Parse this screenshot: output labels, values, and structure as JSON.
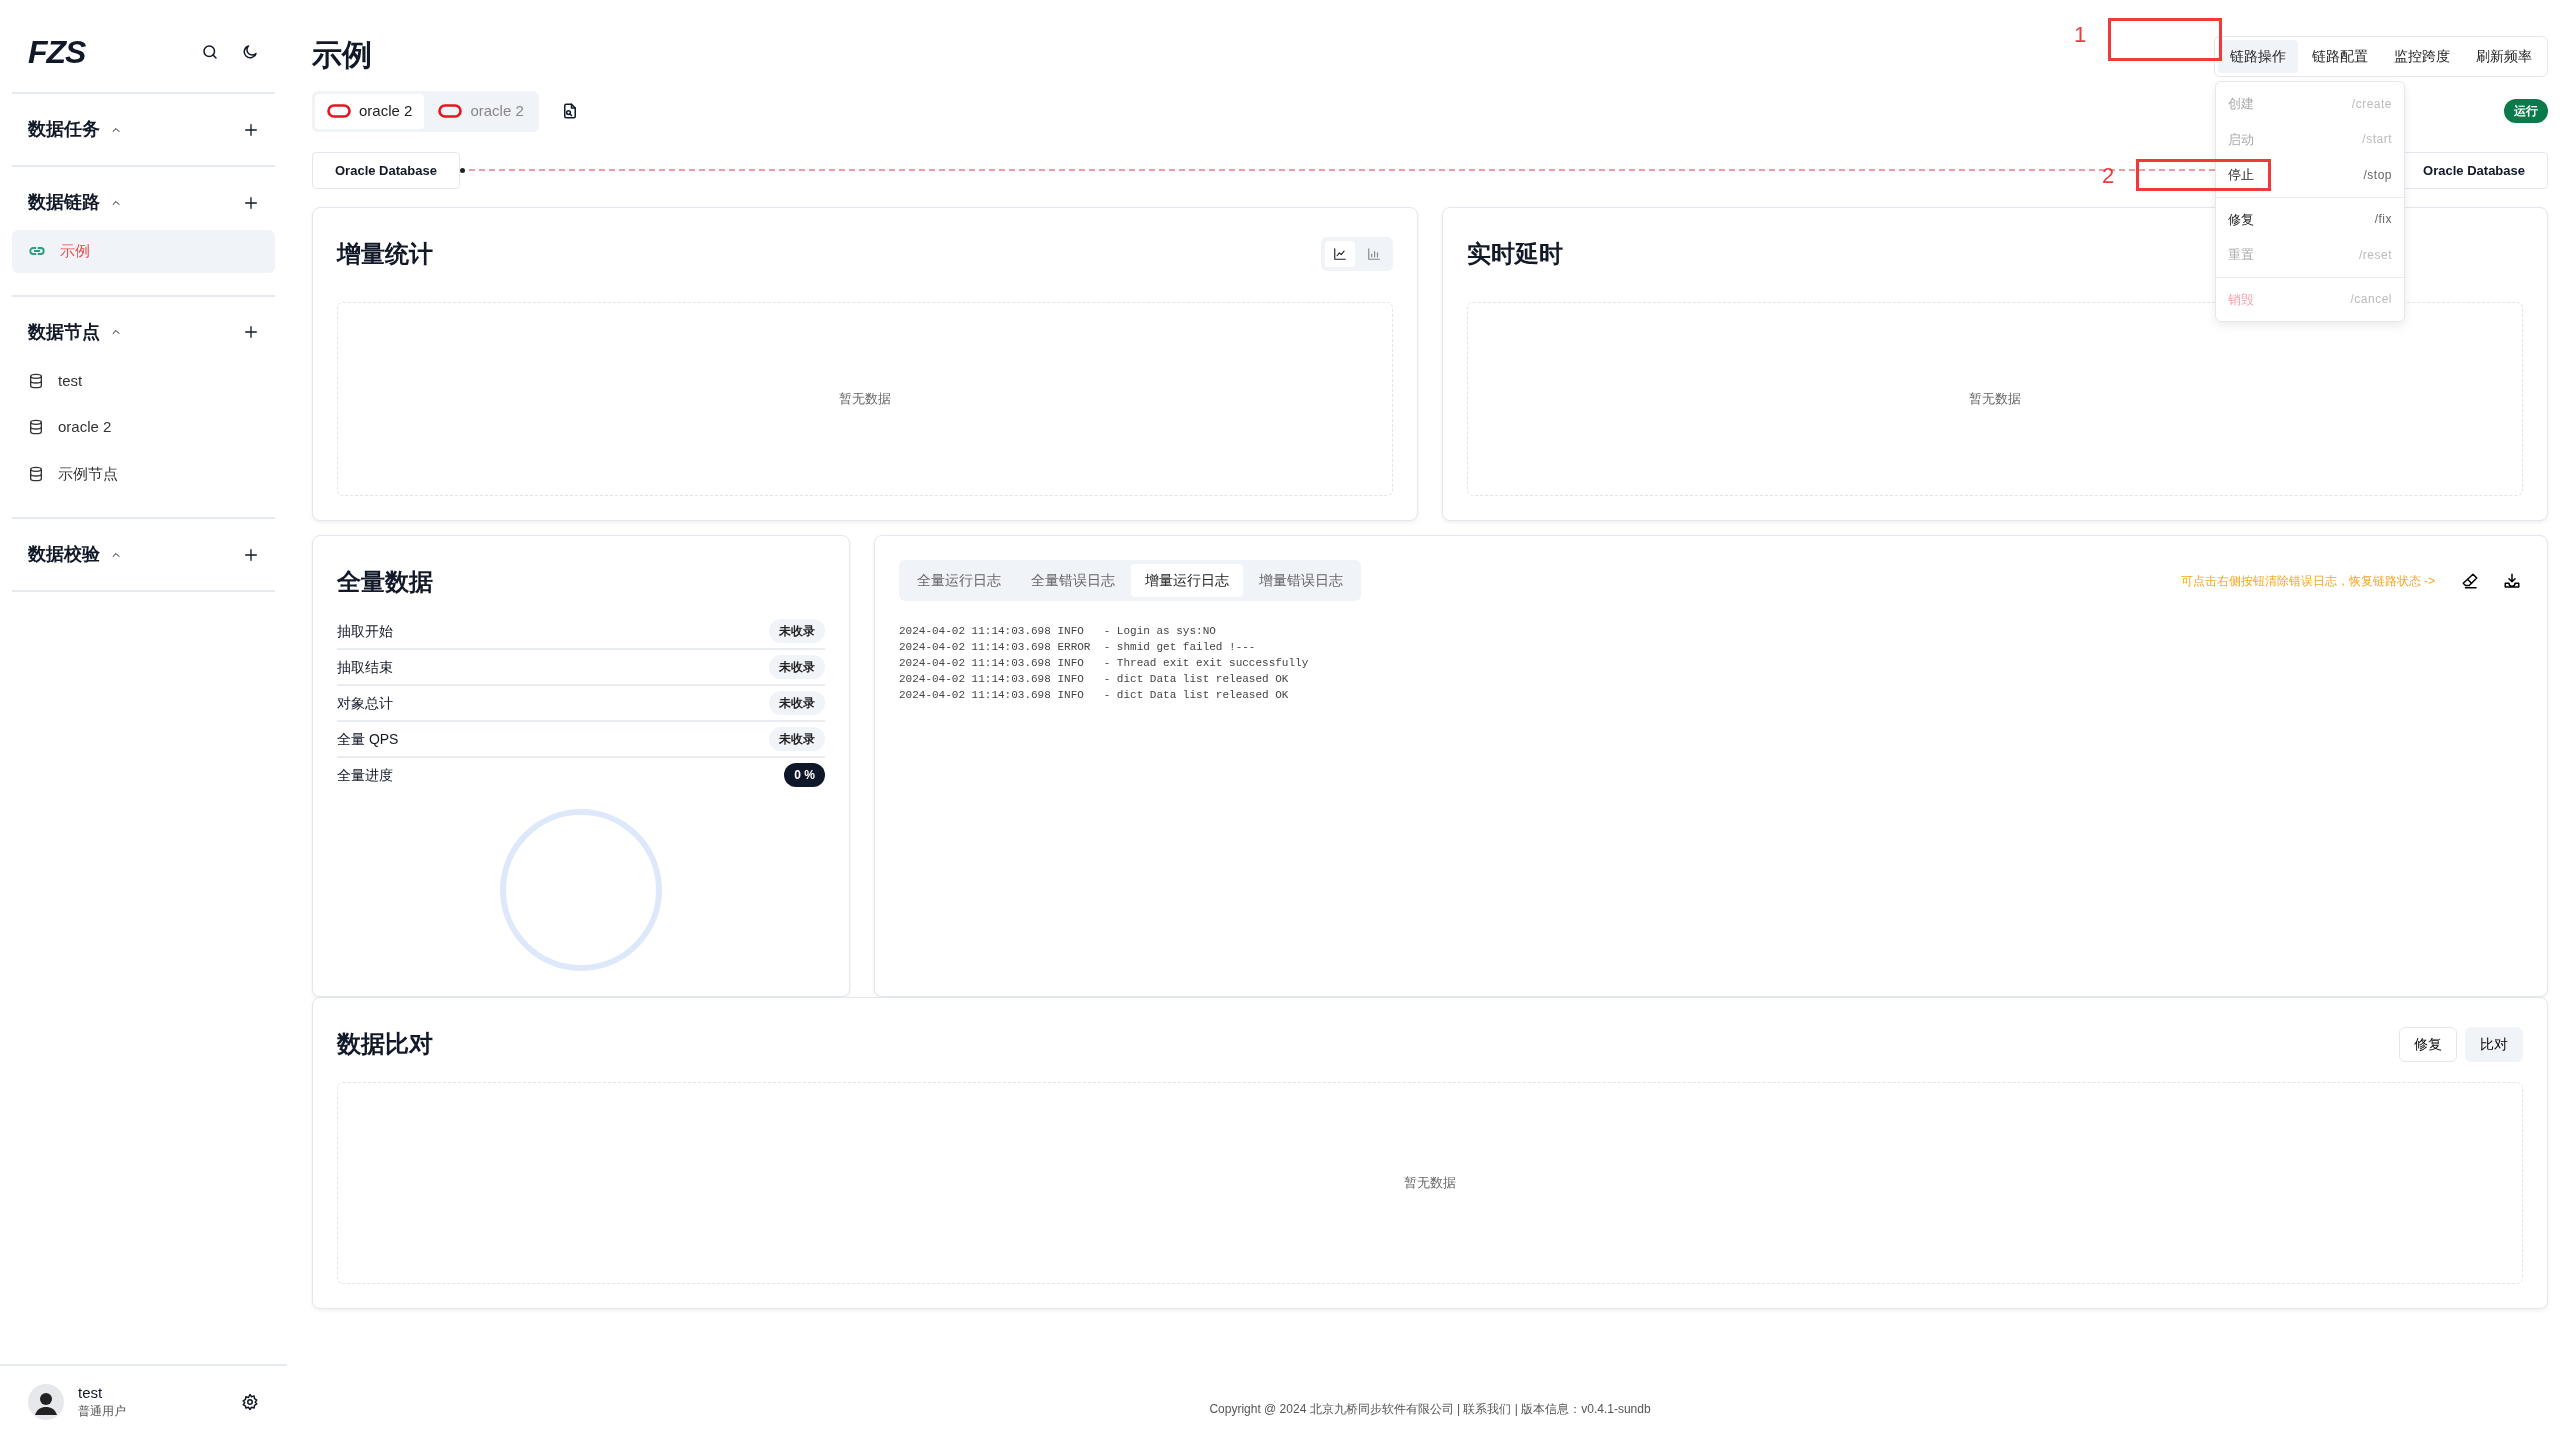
{
  "sidebar": {
    "logo": "FZS",
    "sections": [
      {
        "title": "数据任务",
        "expanded": true
      },
      {
        "title": "数据链路",
        "expanded": true,
        "items": [
          {
            "label": "示例",
            "kind": "link",
            "selected": true
          }
        ]
      },
      {
        "title": "数据节点",
        "expanded": true,
        "items": [
          {
            "label": "test",
            "kind": "database",
            "selected": false
          },
          {
            "label": "oracle 2",
            "kind": "database",
            "selected": false
          },
          {
            "label": "示例节点",
            "kind": "database",
            "selected": false
          }
        ]
      },
      {
        "title": "数据校验",
        "expanded": true
      }
    ],
    "user": {
      "name": "test",
      "role": "普通用户"
    }
  },
  "page_title": "示例",
  "header_tabs": [
    {
      "label": "链路操作",
      "selected": true
    },
    {
      "label": "链路配置",
      "selected": false
    },
    {
      "label": "监控跨度",
      "selected": false
    },
    {
      "label": "刷新频率",
      "selected": false
    }
  ],
  "action_menu": {
    "groups": [
      {
        "items": [
          {
            "label": "创建",
            "command": "/create",
            "disabled": true,
            "kind": "normal"
          },
          {
            "label": "启动",
            "command": "/start",
            "disabled": true,
            "kind": "normal"
          },
          {
            "label": "停止",
            "command": "/stop",
            "disabled": false,
            "kind": "normal"
          }
        ]
      },
      {
        "items": [
          {
            "label": "修复",
            "command": "/fix",
            "disabled": false,
            "kind": "normal"
          },
          {
            "label": "重置",
            "command": "/reset",
            "disabled": true,
            "kind": "normal"
          }
        ]
      },
      {
        "items": [
          {
            "label": "销毁",
            "command": "/cancel",
            "disabled": true,
            "kind": "danger"
          }
        ]
      }
    ]
  },
  "annotations": [
    {
      "label": "1"
    },
    {
      "label": "2"
    }
  ],
  "source_tabs": [
    {
      "label": "oracle 2",
      "selected": true
    },
    {
      "label": "oracle 2",
      "selected": false
    }
  ],
  "status_badge": "运行",
  "link": {
    "source": "Oracle Database",
    "target": "Oracle Database"
  },
  "incremental_stats": {
    "title": "增量统计",
    "view_toggle": [
      {
        "kind": "line",
        "selected": true
      },
      {
        "kind": "bar",
        "selected": false
      }
    ],
    "empty_text": "暂无数据"
  },
  "realtime_latency": {
    "title": "实时延时",
    "empty_text": "暂无数据"
  },
  "full_data": {
    "title": "全量数据",
    "rows": [
      {
        "label": "抽取开始",
        "value": "未收录",
        "kind": "muted"
      },
      {
        "label": "抽取结束",
        "value": "未收录",
        "kind": "muted"
      },
      {
        "label": "对象总计",
        "value": "未收录",
        "kind": "muted"
      },
      {
        "label": "全量 QPS",
        "value": "未收录",
        "kind": "muted"
      },
      {
        "label": "全量进度",
        "value": "0 %",
        "kind": "dark"
      }
    ]
  },
  "logs": {
    "tabs": [
      {
        "label": "全量运行日志",
        "selected": false
      },
      {
        "label": "全量错误日志",
        "selected": false
      },
      {
        "label": "增量运行日志",
        "selected": true
      },
      {
        "label": "增量错误日志",
        "selected": false
      }
    ],
    "hint": "可点击右侧按钮清除错误日志，恢复链路状态 ->",
    "lines": [
      "2024-04-02 11:14:03.698 INFO   - Login as sys:NO",
      "2024-04-02 11:14:03.698 ERROR  - shmid get failed !---",
      "2024-04-02 11:14:03.698 INFO   - Thread exit exit successfully",
      "2024-04-02 11:14:03.698 INFO   - dict Data list released OK",
      "2024-04-02 11:14:03.698 INFO   - dict Data list released OK"
    ]
  },
  "data_compare": {
    "title": "数据比对",
    "buttons": [
      {
        "label": "修复",
        "kind": "outline"
      },
      {
        "label": "比对",
        "kind": "light"
      }
    ],
    "empty_text": "暂无数据"
  },
  "footer": "Copyright @ 2024 北京九桥同步软件有限公司 | 联系我们 | 版本信息：v0.4.1-sundb"
}
